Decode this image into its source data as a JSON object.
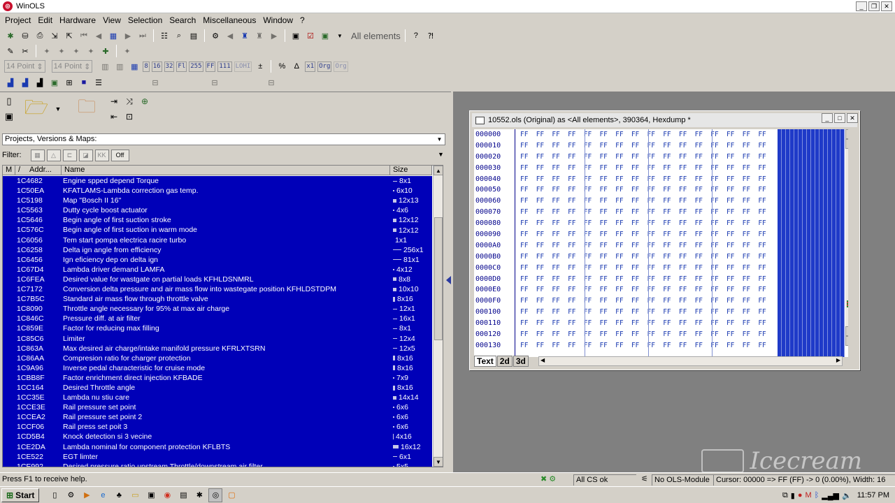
{
  "window": {
    "title": "WinOLS"
  },
  "menu": [
    "Project",
    "Edit",
    "Hardware",
    "View",
    "Selection",
    "Search",
    "Miscellaneous",
    "Window",
    "?"
  ],
  "toolbar1": {
    "elements_label": "All elements"
  },
  "toolbar3": {
    "font_size_a": "14 Point",
    "font_size_b": "14 Point",
    "btn_8": "8",
    "btn_16": "16",
    "btn_32": "32",
    "btn_flt": "Fl",
    "btn_255": "255",
    "btn_ff": "FF",
    "btn_111": "111",
    "btn_lohi": "LOHI",
    "btn_x1": "x1",
    "btn_org": "Org",
    "btn_org2": "Org"
  },
  "project_panel": {
    "combo_value": "Projects, Versions & Maps:",
    "filter_label": "Filter:",
    "filter_off": "Off",
    "columns": {
      "m": "M",
      "sort": "/",
      "addr": "Addr...",
      "name": "Name",
      "size": "Size"
    },
    "rows": [
      {
        "addr": "1C4682",
        "name": "Engine spped depend Torque",
        "size": "8x1",
        "bar": "dash"
      },
      {
        "addr": "1C50EA",
        "name": "KFATLAMS-Lambda correction gas temp.",
        "size": "6x10",
        "bar": "dot"
      },
      {
        "addr": "1C5198",
        "name": "Map \"Bosch II 16\"",
        "size": "12x13",
        "bar": "square"
      },
      {
        "addr": "1C5563",
        "name": "Dutty cycle boost actuator",
        "size": "4x6",
        "bar": "dot"
      },
      {
        "addr": "1C5646",
        "name": "Begin angle of first suction stroke",
        "size": "12x12",
        "bar": "square"
      },
      {
        "addr": "1C576C",
        "name": "Begin angle of first suction in warm mode",
        "size": "12x12",
        "bar": "square"
      },
      {
        "addr": "1C6056",
        "name": "Tem start pompa electrica  racire turbo",
        "size": "1x1",
        "bar": "none"
      },
      {
        "addr": "1C6258",
        "name": "Delta ign angle from efficiency",
        "size": "256x1",
        "bar": "long"
      },
      {
        "addr": "1C6456",
        "name": "Ign eficiency dep on delta ign",
        "size": "81x1",
        "bar": "long"
      },
      {
        "addr": "1C67D4",
        "name": "Lambda driver demand  LAMFA",
        "size": "4x12",
        "bar": "dot"
      },
      {
        "addr": "1C6FEA",
        "name": "Desired value for wastgate on partial loads KFHLDSNMRL",
        "size": "8x8",
        "bar": "square"
      },
      {
        "addr": "1C7172",
        "name": "Conversion delta pressure and air mass flow into  wastegate position  KFHLDSTDPM",
        "size": "10x10",
        "bar": "square"
      },
      {
        "addr": "1C7B5C",
        "name": "Standard air mass flow through throttle valve",
        "size": "8x16",
        "bar": "tall"
      },
      {
        "addr": "1C8090",
        "name": "Throttle angle necessary for 95% at max air charge",
        "size": "12x1",
        "bar": "dash"
      },
      {
        "addr": "1C846C",
        "name": "Pressure diff. at air filter",
        "size": "16x1",
        "bar": "dash"
      },
      {
        "addr": "1C859E",
        "name": "Factor for reducing max filling",
        "size": "8x1",
        "bar": "dash"
      },
      {
        "addr": "1C85C6",
        "name": "Limiter",
        "size": "12x4",
        "bar": "dash"
      },
      {
        "addr": "1C863A",
        "name": "Max desired air charge/intake manifold pressure KFRLXTSRN",
        "size": "12x5",
        "bar": "dash"
      },
      {
        "addr": "1C86AA",
        "name": "Compresion ratio for charger protection",
        "size": "8x16",
        "bar": "tall"
      },
      {
        "addr": "1C9A96",
        "name": "Inverse pedal characteristic  for cruise mode",
        "size": "8x16",
        "bar": "tall"
      },
      {
        "addr": "1CBB8F",
        "name": "Factor enrichment direct injection  KFBADE",
        "size": "7x9",
        "bar": "dot"
      },
      {
        "addr": "1CC164",
        "name": "Desired Throttle angle",
        "size": "8x16",
        "bar": "tall"
      },
      {
        "addr": "1CC35E",
        "name": "Lambda nu stiu care",
        "size": "14x14",
        "bar": "square"
      },
      {
        "addr": "1CCE3E",
        "name": "Rail pressure set point",
        "size": "6x6",
        "bar": "dot"
      },
      {
        "addr": "1CCEA2",
        "name": "Rail pressure set point 2",
        "size": "6x6",
        "bar": "dot"
      },
      {
        "addr": "1CCF06",
        "name": "Rail press set poit 3",
        "size": "6x6",
        "bar": "dot"
      },
      {
        "addr": "1CD5B4",
        "name": "Knock detection  si 3 vecine",
        "size": "4x16",
        "bar": "thin"
      },
      {
        "addr": "1CE2DA",
        "name": "Lambda nominal for component protection  KFLBTS",
        "size": "16x12",
        "bar": "wide"
      },
      {
        "addr": "1CE522",
        "name": "EGT limter",
        "size": "6x1",
        "bar": "dash"
      },
      {
        "addr": "1CE992",
        "name": "Desired pressure ratio upstream Throttle/downstream air filter",
        "size": "5x5",
        "bar": "dot"
      }
    ]
  },
  "hex_window": {
    "title": "10552.ols (Original) as <All elements>, 390364, Hexdump *",
    "addresses": [
      "000000",
      "000010",
      "000020",
      "000030",
      "000040",
      "000050",
      "000060",
      "000070",
      "000080",
      "000090",
      "0000A0",
      "0000B0",
      "0000C0",
      "0000D0",
      "0000E0",
      "0000F0",
      "000100",
      "000110",
      "000120",
      "000130"
    ],
    "byte_value": "FF",
    "tabs": [
      "Text",
      "2d",
      "3d"
    ]
  },
  "status": {
    "help": "Press F1 to receive help.",
    "cs": "All CS ok",
    "module": "No OLS-Module",
    "cursor": "Cursor: 00000 => FF (FF) -> 0 (0.00%), Width: 16"
  },
  "taskbar": {
    "start": "Start",
    "clock": "11:57 PM"
  },
  "watermark": {
    "text": "Icecream"
  },
  "colors": {
    "selection": "#0000b8",
    "hex_text": "#1a3ab0",
    "addr_text": "#00008b"
  }
}
